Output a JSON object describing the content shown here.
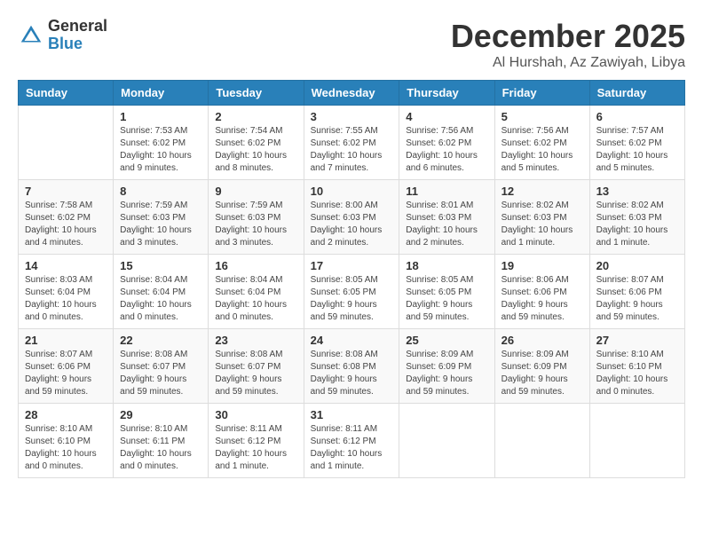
{
  "header": {
    "logo_general": "General",
    "logo_blue": "Blue",
    "month_title": "December 2025",
    "location": "Al Hurshah, Az Zawiyah, Libya"
  },
  "weekdays": [
    "Sunday",
    "Monday",
    "Tuesday",
    "Wednesday",
    "Thursday",
    "Friday",
    "Saturday"
  ],
  "weeks": [
    [
      {
        "day": "",
        "info": ""
      },
      {
        "day": "1",
        "info": "Sunrise: 7:53 AM\nSunset: 6:02 PM\nDaylight: 10 hours\nand 9 minutes."
      },
      {
        "day": "2",
        "info": "Sunrise: 7:54 AM\nSunset: 6:02 PM\nDaylight: 10 hours\nand 8 minutes."
      },
      {
        "day": "3",
        "info": "Sunrise: 7:55 AM\nSunset: 6:02 PM\nDaylight: 10 hours\nand 7 minutes."
      },
      {
        "day": "4",
        "info": "Sunrise: 7:56 AM\nSunset: 6:02 PM\nDaylight: 10 hours\nand 6 minutes."
      },
      {
        "day": "5",
        "info": "Sunrise: 7:56 AM\nSunset: 6:02 PM\nDaylight: 10 hours\nand 5 minutes."
      },
      {
        "day": "6",
        "info": "Sunrise: 7:57 AM\nSunset: 6:02 PM\nDaylight: 10 hours\nand 5 minutes."
      }
    ],
    [
      {
        "day": "7",
        "info": "Sunrise: 7:58 AM\nSunset: 6:02 PM\nDaylight: 10 hours\nand 4 minutes."
      },
      {
        "day": "8",
        "info": "Sunrise: 7:59 AM\nSunset: 6:03 PM\nDaylight: 10 hours\nand 3 minutes."
      },
      {
        "day": "9",
        "info": "Sunrise: 7:59 AM\nSunset: 6:03 PM\nDaylight: 10 hours\nand 3 minutes."
      },
      {
        "day": "10",
        "info": "Sunrise: 8:00 AM\nSunset: 6:03 PM\nDaylight: 10 hours\nand 2 minutes."
      },
      {
        "day": "11",
        "info": "Sunrise: 8:01 AM\nSunset: 6:03 PM\nDaylight: 10 hours\nand 2 minutes."
      },
      {
        "day": "12",
        "info": "Sunrise: 8:02 AM\nSunset: 6:03 PM\nDaylight: 10 hours\nand 1 minute."
      },
      {
        "day": "13",
        "info": "Sunrise: 8:02 AM\nSunset: 6:03 PM\nDaylight: 10 hours\nand 1 minute."
      }
    ],
    [
      {
        "day": "14",
        "info": "Sunrise: 8:03 AM\nSunset: 6:04 PM\nDaylight: 10 hours\nand 0 minutes."
      },
      {
        "day": "15",
        "info": "Sunrise: 8:04 AM\nSunset: 6:04 PM\nDaylight: 10 hours\nand 0 minutes."
      },
      {
        "day": "16",
        "info": "Sunrise: 8:04 AM\nSunset: 6:04 PM\nDaylight: 10 hours\nand 0 minutes."
      },
      {
        "day": "17",
        "info": "Sunrise: 8:05 AM\nSunset: 6:05 PM\nDaylight: 9 hours\nand 59 minutes."
      },
      {
        "day": "18",
        "info": "Sunrise: 8:05 AM\nSunset: 6:05 PM\nDaylight: 9 hours\nand 59 minutes."
      },
      {
        "day": "19",
        "info": "Sunrise: 8:06 AM\nSunset: 6:06 PM\nDaylight: 9 hours\nand 59 minutes."
      },
      {
        "day": "20",
        "info": "Sunrise: 8:07 AM\nSunset: 6:06 PM\nDaylight: 9 hours\nand 59 minutes."
      }
    ],
    [
      {
        "day": "21",
        "info": "Sunrise: 8:07 AM\nSunset: 6:06 PM\nDaylight: 9 hours\nand 59 minutes."
      },
      {
        "day": "22",
        "info": "Sunrise: 8:08 AM\nSunset: 6:07 PM\nDaylight: 9 hours\nand 59 minutes."
      },
      {
        "day": "23",
        "info": "Sunrise: 8:08 AM\nSunset: 6:07 PM\nDaylight: 9 hours\nand 59 minutes."
      },
      {
        "day": "24",
        "info": "Sunrise: 8:08 AM\nSunset: 6:08 PM\nDaylight: 9 hours\nand 59 minutes."
      },
      {
        "day": "25",
        "info": "Sunrise: 8:09 AM\nSunset: 6:09 PM\nDaylight: 9 hours\nand 59 minutes."
      },
      {
        "day": "26",
        "info": "Sunrise: 8:09 AM\nSunset: 6:09 PM\nDaylight: 9 hours\nand 59 minutes."
      },
      {
        "day": "27",
        "info": "Sunrise: 8:10 AM\nSunset: 6:10 PM\nDaylight: 10 hours\nand 0 minutes."
      }
    ],
    [
      {
        "day": "28",
        "info": "Sunrise: 8:10 AM\nSunset: 6:10 PM\nDaylight: 10 hours\nand 0 minutes."
      },
      {
        "day": "29",
        "info": "Sunrise: 8:10 AM\nSunset: 6:11 PM\nDaylight: 10 hours\nand 0 minutes."
      },
      {
        "day": "30",
        "info": "Sunrise: 8:11 AM\nSunset: 6:12 PM\nDaylight: 10 hours\nand 1 minute."
      },
      {
        "day": "31",
        "info": "Sunrise: 8:11 AM\nSunset: 6:12 PM\nDaylight: 10 hours\nand 1 minute."
      },
      {
        "day": "",
        "info": ""
      },
      {
        "day": "",
        "info": ""
      },
      {
        "day": "",
        "info": ""
      }
    ]
  ]
}
